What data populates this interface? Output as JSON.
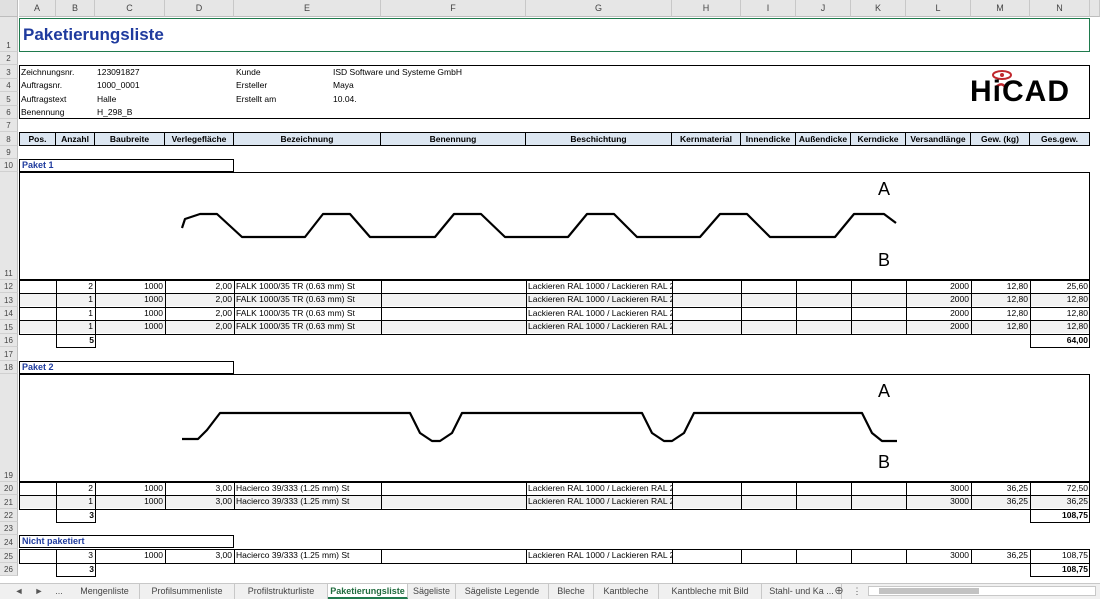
{
  "columns": [
    "A",
    "B",
    "C",
    "D",
    "E",
    "F",
    "G",
    "H",
    "I",
    "J",
    "K",
    "L",
    "M",
    "N",
    "O"
  ],
  "rows": [
    "1",
    "2",
    "3",
    "4",
    "5",
    "6",
    "7",
    "8",
    "9",
    "10",
    "11",
    "12",
    "13",
    "14",
    "15",
    "16",
    "17",
    "18",
    "19",
    "20",
    "21",
    "22",
    "23",
    "24",
    "25",
    "26"
  ],
  "title": "Paketierungsliste",
  "info": {
    "zeichnungsnr_label": "Zeichnungsnr.",
    "zeichnungsnr": "123091827",
    "auftragsnr_label": "Auftragsnr.",
    "auftragsnr": "1000_0001",
    "auftragstext_label": "Auftragstext",
    "auftragstext": "Halle",
    "benennung_label": "Benennung",
    "benennung": "H_298_B",
    "kunde_label": "Kunde",
    "kunde": "ISD Software und Systeme GmbH",
    "ersteller_label": "Ersteller",
    "ersteller": "Maya",
    "erstellt_label": "Erstellt am",
    "erstellt": "10.04."
  },
  "logo_text": "HiCAD",
  "headers": [
    "Pos.",
    "Anzahl",
    "Baubreite",
    "Verlegefläche",
    "Bezeichnung",
    "Benennung",
    "Beschichtung",
    "Kernmaterial",
    "Innendicke",
    "Außendicke",
    "Kerndicke",
    "Versandlänge",
    "Gew. (kg)",
    "Ges.gew."
  ],
  "paket1": {
    "label": "Paket 1",
    "side_a": "A",
    "side_b": "B",
    "rows": [
      {
        "anzahl": "2",
        "baubreite": "1000",
        "flaeche": "2,00",
        "bezeichnung": "FALK 1000/35 TR (0.63 mm) St",
        "beschichtung": "Lackieren RAL 1000 / Lackieren RAL 2002",
        "laenge": "2000",
        "gew": "12,80",
        "gesgew": "25,60"
      },
      {
        "anzahl": "1",
        "baubreite": "1000",
        "flaeche": "2,00",
        "bezeichnung": "FALK 1000/35 TR (0.63 mm) St",
        "beschichtung": "Lackieren RAL 1000 / Lackieren RAL 2002",
        "laenge": "2000",
        "gew": "12,80",
        "gesgew": "12,80"
      },
      {
        "anzahl": "1",
        "baubreite": "1000",
        "flaeche": "2,00",
        "bezeichnung": "FALK 1000/35 TR (0.63 mm) St",
        "beschichtung": "Lackieren RAL 1000 / Lackieren RAL 2002",
        "laenge": "2000",
        "gew": "12,80",
        "gesgew": "12,80"
      },
      {
        "anzahl": "1",
        "baubreite": "1000",
        "flaeche": "2,00",
        "bezeichnung": "FALK 1000/35 TR (0.63 mm) St",
        "beschichtung": "Lackieren RAL 1000 / Lackieren RAL 2002",
        "laenge": "2000",
        "gew": "12,80",
        "gesgew": "12,80"
      }
    ],
    "sum_anzahl": "5",
    "sum_gesgew": "64,00"
  },
  "paket2": {
    "label": "Paket 2",
    "side_a": "A",
    "side_b": "B",
    "rows": [
      {
        "anzahl": "2",
        "baubreite": "1000",
        "flaeche": "3,00",
        "bezeichnung": "Hacierco 39/333 (1.25 mm) St",
        "beschichtung": "Lackieren RAL 1000 / Lackieren RAL 2005",
        "laenge": "3000",
        "gew": "36,25",
        "gesgew": "72,50"
      },
      {
        "anzahl": "1",
        "baubreite": "1000",
        "flaeche": "3,00",
        "bezeichnung": "Hacierco 39/333 (1.25 mm) St",
        "beschichtung": "Lackieren RAL 1000 / Lackieren RAL 2005",
        "laenge": "3000",
        "gew": "36,25",
        "gesgew": "36,25"
      }
    ],
    "sum_anzahl": "3",
    "sum_gesgew": "108,75"
  },
  "nicht": {
    "label": "Nicht paketiert",
    "rows": [
      {
        "anzahl": "3",
        "baubreite": "1000",
        "flaeche": "3,00",
        "bezeichnung": "Hacierco 39/333 (1.25 mm) St",
        "beschichtung": "Lackieren RAL 1000 / Lackieren RAL 2005",
        "laenge": "3000",
        "gew": "36,25",
        "gesgew": "108,75"
      }
    ],
    "sum_anzahl": "3",
    "sum_gesgew": "108,75"
  },
  "tabs": {
    "nav_prev": "◄",
    "nav_next": "►",
    "more": "...",
    "items": [
      "Mengenliste",
      "Profilsummenliste",
      "Profilstrukturliste",
      "Paketierungsliste",
      "Sägeliste",
      "Sägeliste Legende",
      "Bleche",
      "Kantbleche",
      "Kantbleche mit Bild",
      "Stahl- und Ka ..."
    ],
    "add": "⊕",
    "menu": "⋮"
  },
  "colors": {
    "accent": "#1f7a4d",
    "title": "#1f3b9e",
    "header_bg": "#dce6f1"
  }
}
